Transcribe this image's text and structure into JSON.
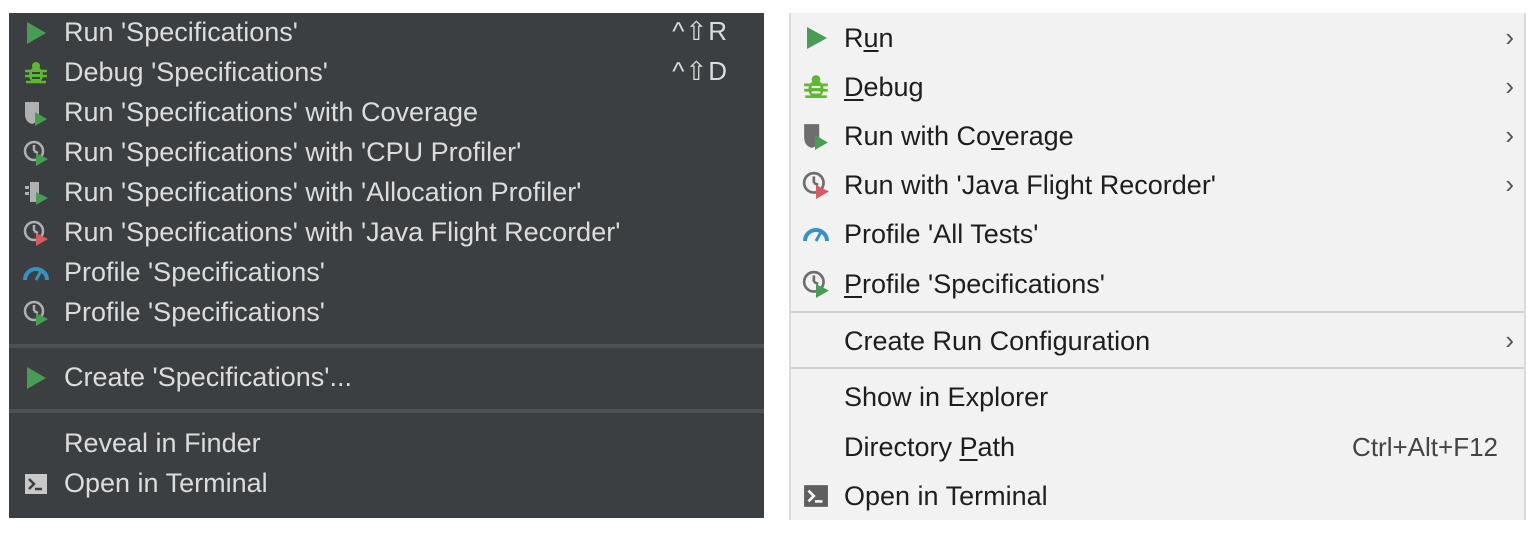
{
  "colors": {
    "dark_bg": "#3c3f41",
    "dark_text": "#dcdcdc",
    "light_bg": "#f2f2f2",
    "light_text": "#1e1e1e",
    "run_green": "#499c54",
    "debug_green": "#5fb832",
    "profiler_blue": "#3592c4",
    "recorder_red": "#db5860"
  },
  "dark_menu": {
    "items": [
      {
        "label": "Run 'Specifications'",
        "shortcut": "^⇧R",
        "icon": "run-icon"
      },
      {
        "label": "Debug 'Specifications'",
        "shortcut": "^⇧D",
        "icon": "debug-icon"
      },
      {
        "label": "Run 'Specifications' with Coverage",
        "icon": "coverage-icon"
      },
      {
        "label": "Run 'Specifications' with 'CPU Profiler'",
        "icon": "cpu-profiler-icon"
      },
      {
        "label": "Run 'Specifications' with 'Allocation Profiler'",
        "icon": "allocation-profiler-icon"
      },
      {
        "label": "Run 'Specifications' with 'Java Flight Recorder'",
        "icon": "flight-recorder-icon"
      },
      {
        "label": "Profile 'Specifications'",
        "icon": "profiler-gauge-icon"
      },
      {
        "label": "Profile 'Specifications'",
        "icon": "profile-run-icon"
      },
      {
        "label": "Create 'Specifications'...",
        "icon": "run-icon"
      },
      {
        "label": "Reveal in Finder"
      },
      {
        "label": "Open in Terminal",
        "icon": "terminal-icon"
      }
    ]
  },
  "light_menu": {
    "items": [
      {
        "label_pre": "R",
        "label_u": "u",
        "label_post": "n",
        "icon": "run-icon",
        "submenu": "›"
      },
      {
        "label_pre": "",
        "label_u": "D",
        "label_post": "ebug",
        "icon": "debug-icon",
        "submenu": "›"
      },
      {
        "label_pre": "Run with Co",
        "label_u": "v",
        "label_post": "erage",
        "icon": "coverage-icon",
        "submenu": "›"
      },
      {
        "label_pre": "Run with 'Java Flight Recorder'",
        "label_u": "",
        "label_post": "",
        "icon": "flight-recorder-icon",
        "submenu": "›"
      },
      {
        "label_pre": "Profile 'All Tests'",
        "label_u": "",
        "label_post": "",
        "icon": "profiler-gauge-icon"
      },
      {
        "label_pre": "",
        "label_u": "P",
        "label_post": "rofile 'Specifications'",
        "icon": "profile-run-icon"
      },
      {
        "label_pre": "Create Run Configuration",
        "label_u": "",
        "label_post": "",
        "submenu": "›"
      },
      {
        "label_pre": "Show in Explorer",
        "label_u": "",
        "label_post": ""
      },
      {
        "label_pre": "Directory ",
        "label_u": "P",
        "label_post": "ath",
        "shortcut": "Ctrl+Alt+F12"
      },
      {
        "label_pre": "Open in Terminal",
        "label_u": "",
        "label_post": "",
        "icon": "terminal-icon"
      }
    ]
  }
}
